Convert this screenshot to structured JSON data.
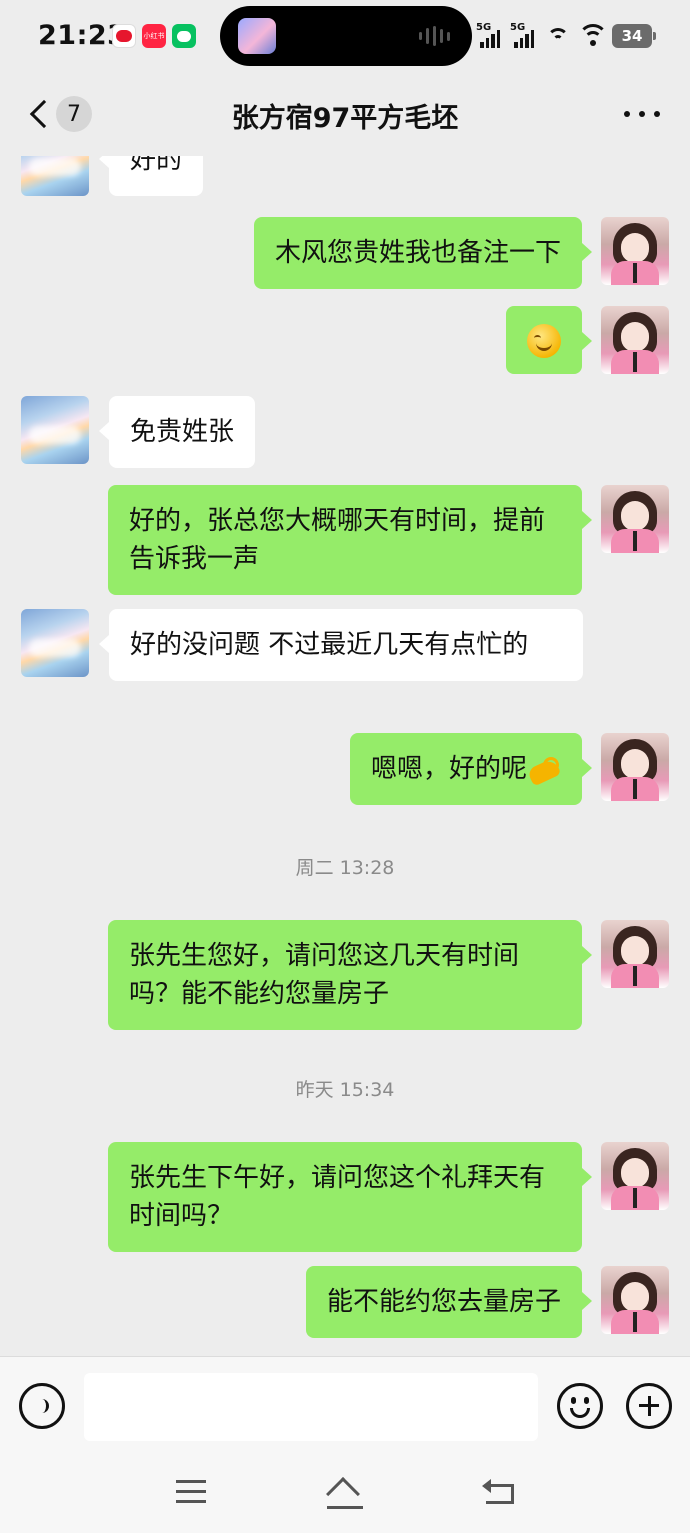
{
  "status_bar": {
    "time": "21:23",
    "app_icons": [
      "weibo-icon",
      "xiaohongshu-icon",
      "wechat-icon"
    ],
    "xiaohongshu_label": "小红书",
    "signal_1": "5G",
    "signal_2": "5G",
    "battery": "34"
  },
  "header": {
    "unread_count": "7",
    "title": "张方宿97平方毛坯"
  },
  "messages": [
    {
      "side": "left",
      "text": "好的"
    },
    {
      "side": "right",
      "text": "木风您贵姓我也备注一下"
    },
    {
      "side": "right",
      "emoji": "smiling-face-icon"
    },
    {
      "side": "left",
      "text": "免贵姓张"
    },
    {
      "side": "right",
      "text": "好的，张总您大概哪天有时间，提前告诉我一声"
    },
    {
      "side": "left",
      "text": "好的没问题 不过最近几天有点忙的"
    },
    {
      "side": "right",
      "text": "嗯嗯，好的呢",
      "emoji": "ok-hand-icon"
    },
    {
      "side": "right",
      "text": "张先生您好，请问您这几天有时间吗？能不能约您量房子"
    },
    {
      "side": "right",
      "text": "张先生下午好，请问您这个礼拜天有时间吗？"
    },
    {
      "side": "right",
      "text": "能不能约您去量房子"
    }
  ],
  "timestamps": [
    "周二 13:28",
    "昨天 15:34"
  ],
  "input": {
    "placeholder": ""
  },
  "colors": {
    "background": "#ededed",
    "bubble_sent": "#95ec69",
    "bubble_received": "#ffffff",
    "timestamp": "#8a8a8a"
  }
}
